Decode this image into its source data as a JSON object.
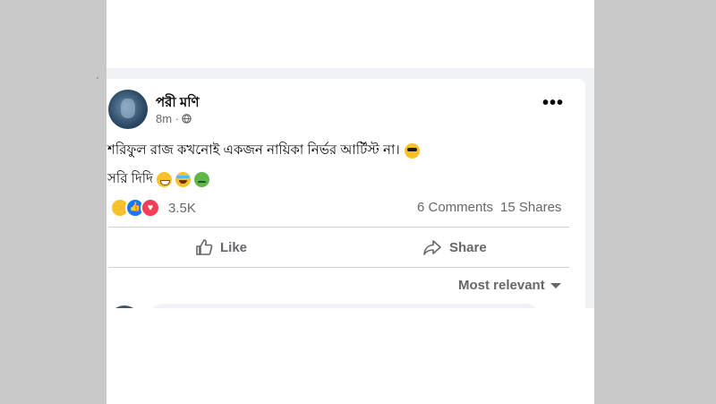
{
  "post": {
    "author": "পরী মণি",
    "time": "8m ·",
    "text_line1": "শরিফুল রাজ কখনোই একজন নায়িকা নির্ভর আর্টিস্ট না।",
    "text_line2": "সরি দিদি",
    "more_icon": "•••",
    "icons": {
      "audience": "globe-icon",
      "options": "more-icon",
      "emoji1": "sunglasses-emoji",
      "emoji2": "grinning-emoji",
      "emoji3": "laughing-emoji",
      "emoji4": "frog-emoji"
    }
  },
  "reactions": {
    "count": "3.5K",
    "types": [
      "haha",
      "like",
      "love"
    ],
    "like_glyph": "👍",
    "love_glyph": "♥"
  },
  "stats": {
    "comments": "6 Comments",
    "shares": "15 Shares"
  },
  "actions": {
    "like_label": "Like",
    "share_label": "Share"
  },
  "comments": {
    "sort_label": "Most relevant"
  },
  "colors": {
    "secondary_text": "#65676b",
    "like_blue": "#1877f2",
    "love_red": "#f33e58",
    "background": "#c9c9c9"
  }
}
